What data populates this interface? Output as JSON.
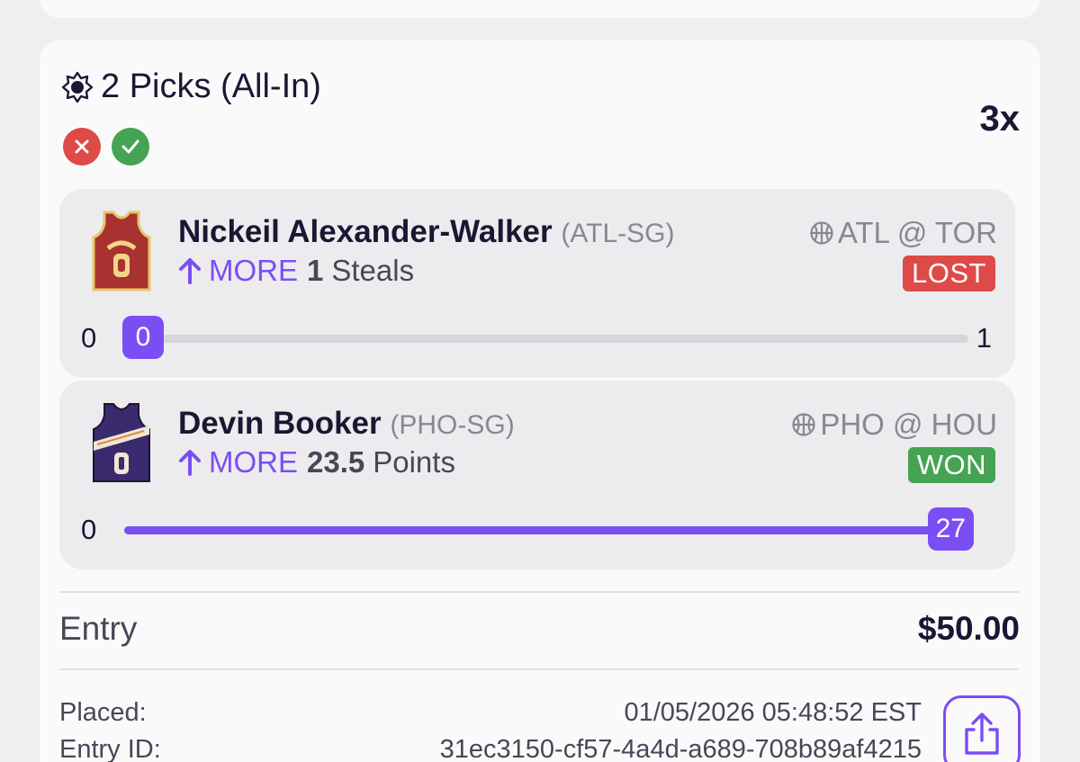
{
  "header": {
    "title": "2 Picks (All-In)",
    "multiplier": "3x",
    "result_icons": [
      "x-icon",
      "check-icon"
    ]
  },
  "picks": [
    {
      "player": "Nickeil Alexander-Walker",
      "position": "(ATL-SG)",
      "direction": "MORE",
      "line": "1",
      "stat": "Steals",
      "matchup": "ATL @ TOR",
      "status": "LOST",
      "range_low": "0",
      "range_high": "1",
      "actual": "0",
      "progress_fraction": 0.0,
      "jersey_color": "#a8322f"
    },
    {
      "player": "Devin Booker",
      "position": "(PHO-SG)",
      "direction": "MORE",
      "line": "23.5",
      "stat": "Points",
      "matchup": "PHO @ HOU",
      "status": "WON",
      "range_low": "0",
      "actual": "27",
      "progress_fraction": 1.0,
      "jersey_color": "#3b2a6e"
    }
  ],
  "entry": {
    "label": "Entry",
    "value": "$50.00"
  },
  "meta": {
    "placed_label": "Placed:",
    "placed_value": "01/05/2026 05:48:52 EST",
    "entry_id_label": "Entry ID:",
    "entry_id_value": "31ec3150-cf57-4a4d-a689-708b89af4215"
  },
  "colors": {
    "accent": "#7b4ef3",
    "lost": "#dd4a47",
    "won": "#45a353"
  }
}
